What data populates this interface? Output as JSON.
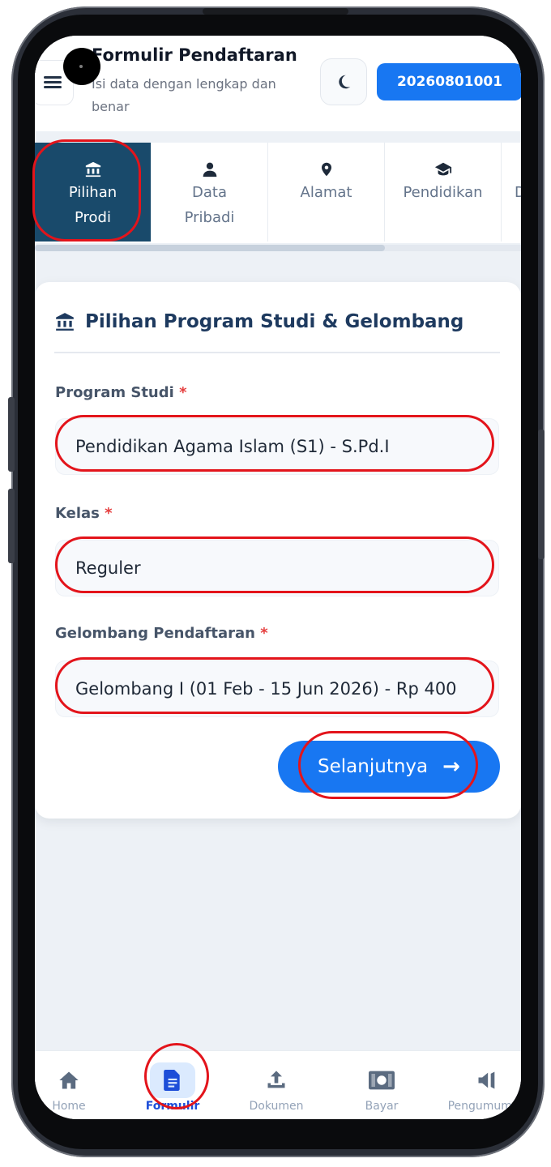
{
  "header": {
    "title": "Formulir Pendaftaran",
    "subtitle": "Isi data dengan lengkap dan benar",
    "registration_id": "20260801001"
  },
  "steps": [
    {
      "label_line1": "Pilihan",
      "label_line2": "Prodi",
      "icon": "university-icon",
      "active": true
    },
    {
      "label_line1": "Data",
      "label_line2": "Pribadi",
      "icon": "user-icon",
      "active": false
    },
    {
      "label_line1": "Alamat",
      "label_line2": "",
      "icon": "map-pin-icon",
      "active": false
    },
    {
      "label_line1": "Pendidikan",
      "label_line2": "",
      "icon": "graduation-cap-icon",
      "active": false
    },
    {
      "label_line1": "D",
      "label_line2": "",
      "icon": "",
      "active": false
    }
  ],
  "card": {
    "title": "Pilihan Program Studi & Gelombang",
    "fields": {
      "program_studi": {
        "label": "Program Studi",
        "required_mark": "*",
        "value": "Pendidikan Agama Islam (S1) - S.Pd.I"
      },
      "kelas": {
        "label": "Kelas",
        "required_mark": "*",
        "value": "Reguler"
      },
      "gelombang": {
        "label": "Gelombang Pendaftaran",
        "required_mark": "*",
        "value": "Gelombang I (01 Feb - 15 Jun 2026) - Rp 400"
      }
    },
    "next_label": "Selanjutnya",
    "next_icon": "→"
  },
  "bottom_nav": [
    {
      "label": "Home",
      "icon": "home-icon",
      "active": false
    },
    {
      "label": "Formulir",
      "icon": "document-icon",
      "active": true
    },
    {
      "label": "Dokumen",
      "icon": "upload-icon",
      "active": false
    },
    {
      "label": "Bayar",
      "icon": "money-icon",
      "active": false
    },
    {
      "label": "Pengumuman",
      "icon": "megaphone-icon",
      "active": false
    }
  ],
  "colors": {
    "accent": "#1877f2",
    "step_active": "#194a6b",
    "annotation": "#e3141b",
    "required": "#e53e3e"
  }
}
